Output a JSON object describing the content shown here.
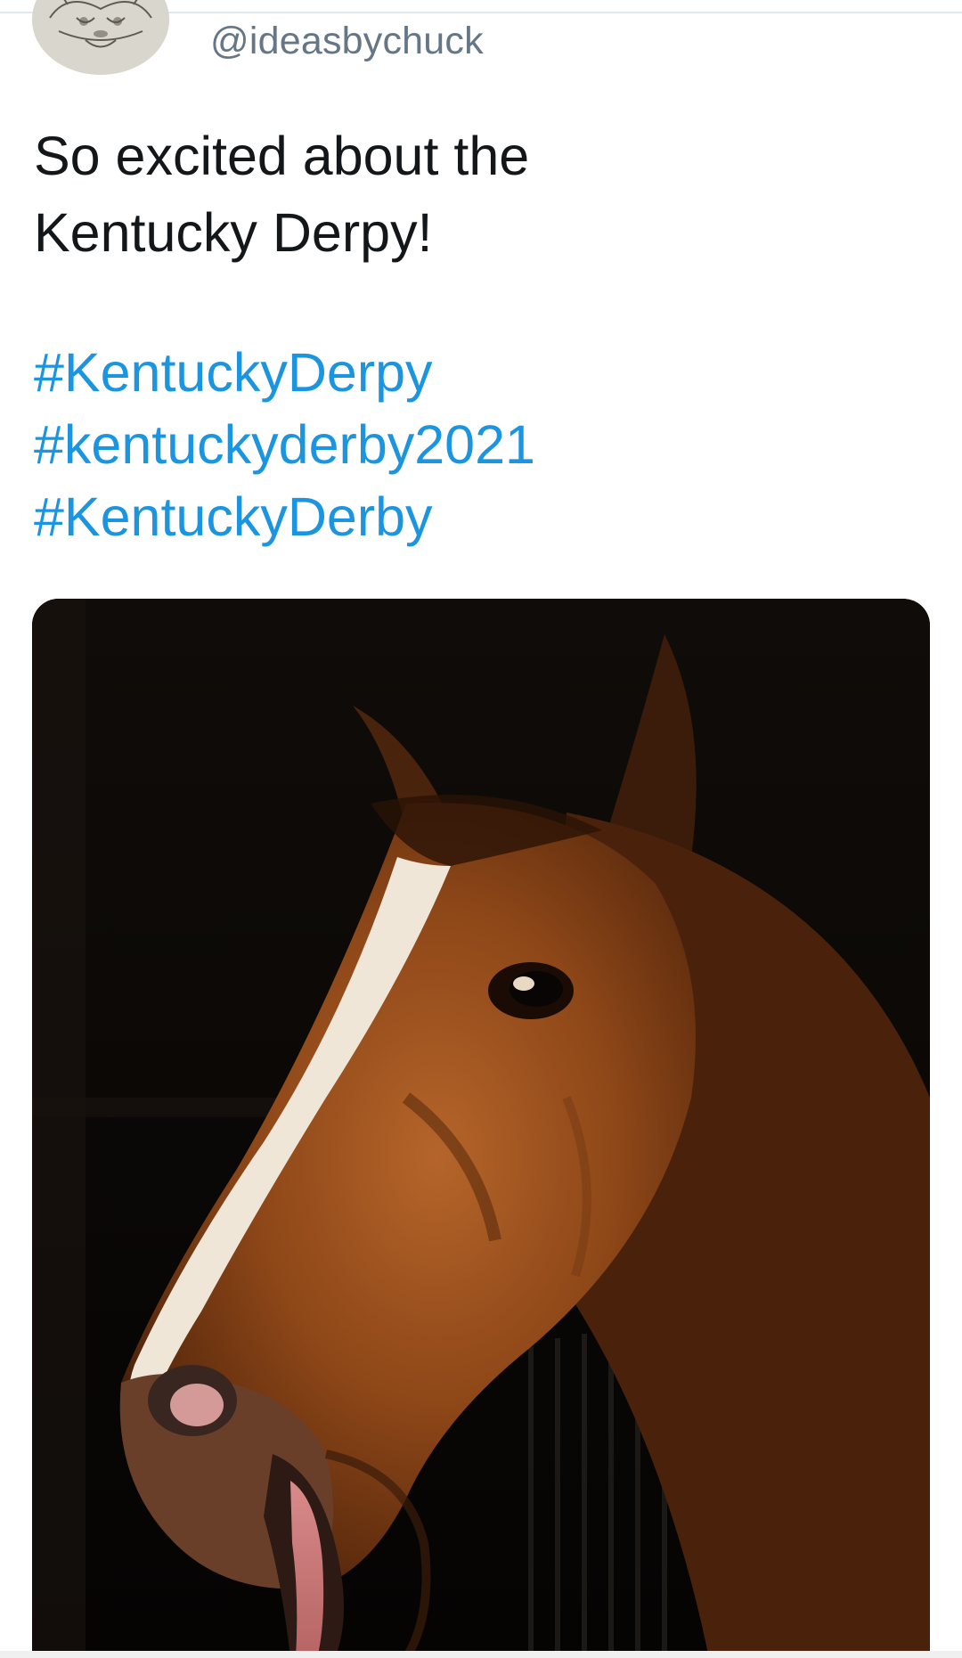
{
  "tweet": {
    "handle": "@ideasbychuck",
    "text_lines": [
      "So excited about the",
      "Kentucky Derpy!"
    ],
    "hashtags": [
      "#KentuckyDerpy",
      "#kentuckyderby2021",
      "#KentuckyDerby"
    ]
  },
  "colors": {
    "handle": "#657786",
    "text": "#14171a",
    "hashtag": "#1b95e0",
    "divider": "#e1e8ed"
  },
  "icons": {
    "avatar": "avatar-image",
    "media": "horse-photo"
  }
}
